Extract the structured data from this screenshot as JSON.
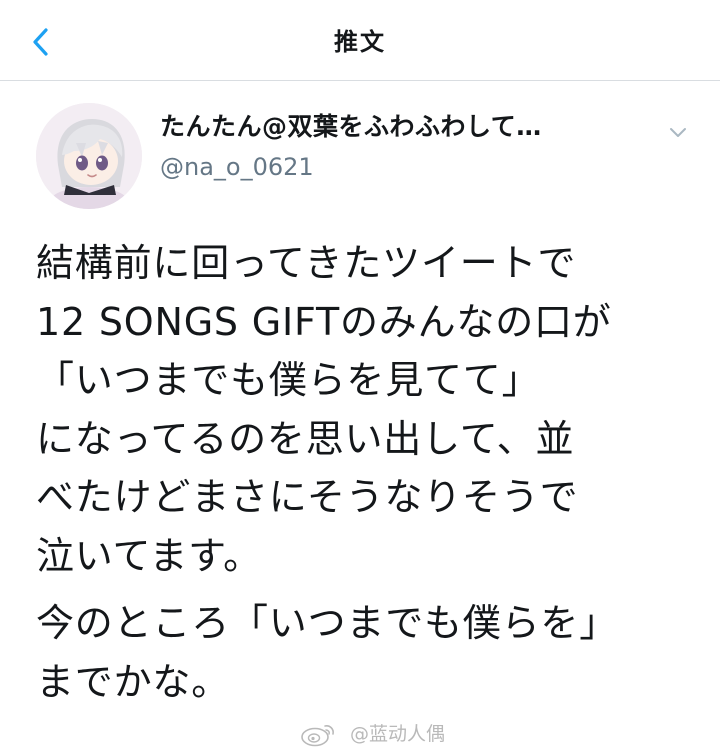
{
  "navbar": {
    "title": "推文",
    "back_icon": "chevron-left-icon",
    "accent_color": "#1da1f2"
  },
  "tweet": {
    "author": {
      "display_name": "たんたん@双葉をふわふわして…",
      "handle": "@na_o_0621",
      "avatar_icon": "avatar-plush-icon"
    },
    "menu_icon": "chevron-down-icon",
    "body": {
      "paragraphs": [
        {
          "lines": [
            "結構前に回ってきたツイートで",
            "12 SONGS GIFTのみんなの口が",
            "「いつまでも僕らを見てて」",
            "になってるのを思い出して、並",
            "べたけどまさにそうなりそうで",
            "泣いてます。"
          ]
        },
        {
          "lines": [
            "今のところ「いつまでも僕らを」",
            "までかな。"
          ]
        }
      ]
    }
  },
  "watermark": {
    "icon": "weibo-logo-icon",
    "text": "@蓝动人偶"
  }
}
